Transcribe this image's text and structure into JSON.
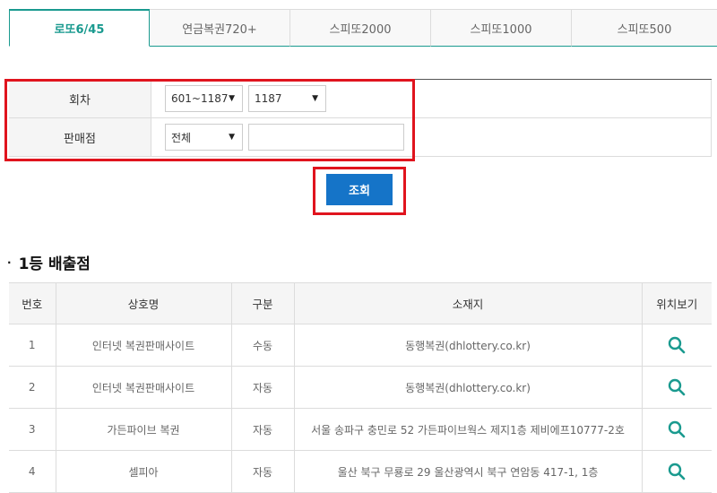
{
  "tabs": [
    {
      "label": "로또6/45",
      "active": true
    },
    {
      "label": "연금복권720+",
      "active": false
    },
    {
      "label": "스피또2000",
      "active": false
    },
    {
      "label": "스피또1000",
      "active": false
    },
    {
      "label": "스피또500",
      "active": false
    }
  ],
  "search": {
    "round_label": "회차",
    "round_range_value": "601~1187",
    "round_value": "1187",
    "store_label": "판매점",
    "region_value": "전체",
    "store_input_value": ""
  },
  "submit_label": "조회",
  "section_title": "1등 배출점",
  "table": {
    "headers": [
      "번호",
      "상호명",
      "구분",
      "소재지",
      "위치보기"
    ],
    "rows": [
      {
        "no": "1",
        "name": "인터넷 복권판매사이트",
        "type": "수동",
        "address": "동행복권(dhlottery.co.kr)"
      },
      {
        "no": "2",
        "name": "인터넷 복권판매사이트",
        "type": "자동",
        "address": "동행복권(dhlottery.co.kr)"
      },
      {
        "no": "3",
        "name": "가든파이브 복권",
        "type": "자동",
        "address": "서울 송파구 충민로 52 가든파이브웍스 제지1층 제비에프10777-2호"
      },
      {
        "no": "4",
        "name": "셀피아",
        "type": "자동",
        "address": "울산 북구 무룡로 29 울산광역시 북구 연암동 417-1, 1층"
      }
    ]
  },
  "colors": {
    "accent": "#1a9a8f",
    "button": "#1574c8",
    "highlight": "#e0141e",
    "search_icon": "#1a9a8f"
  },
  "icons": {
    "location": "search-icon"
  }
}
